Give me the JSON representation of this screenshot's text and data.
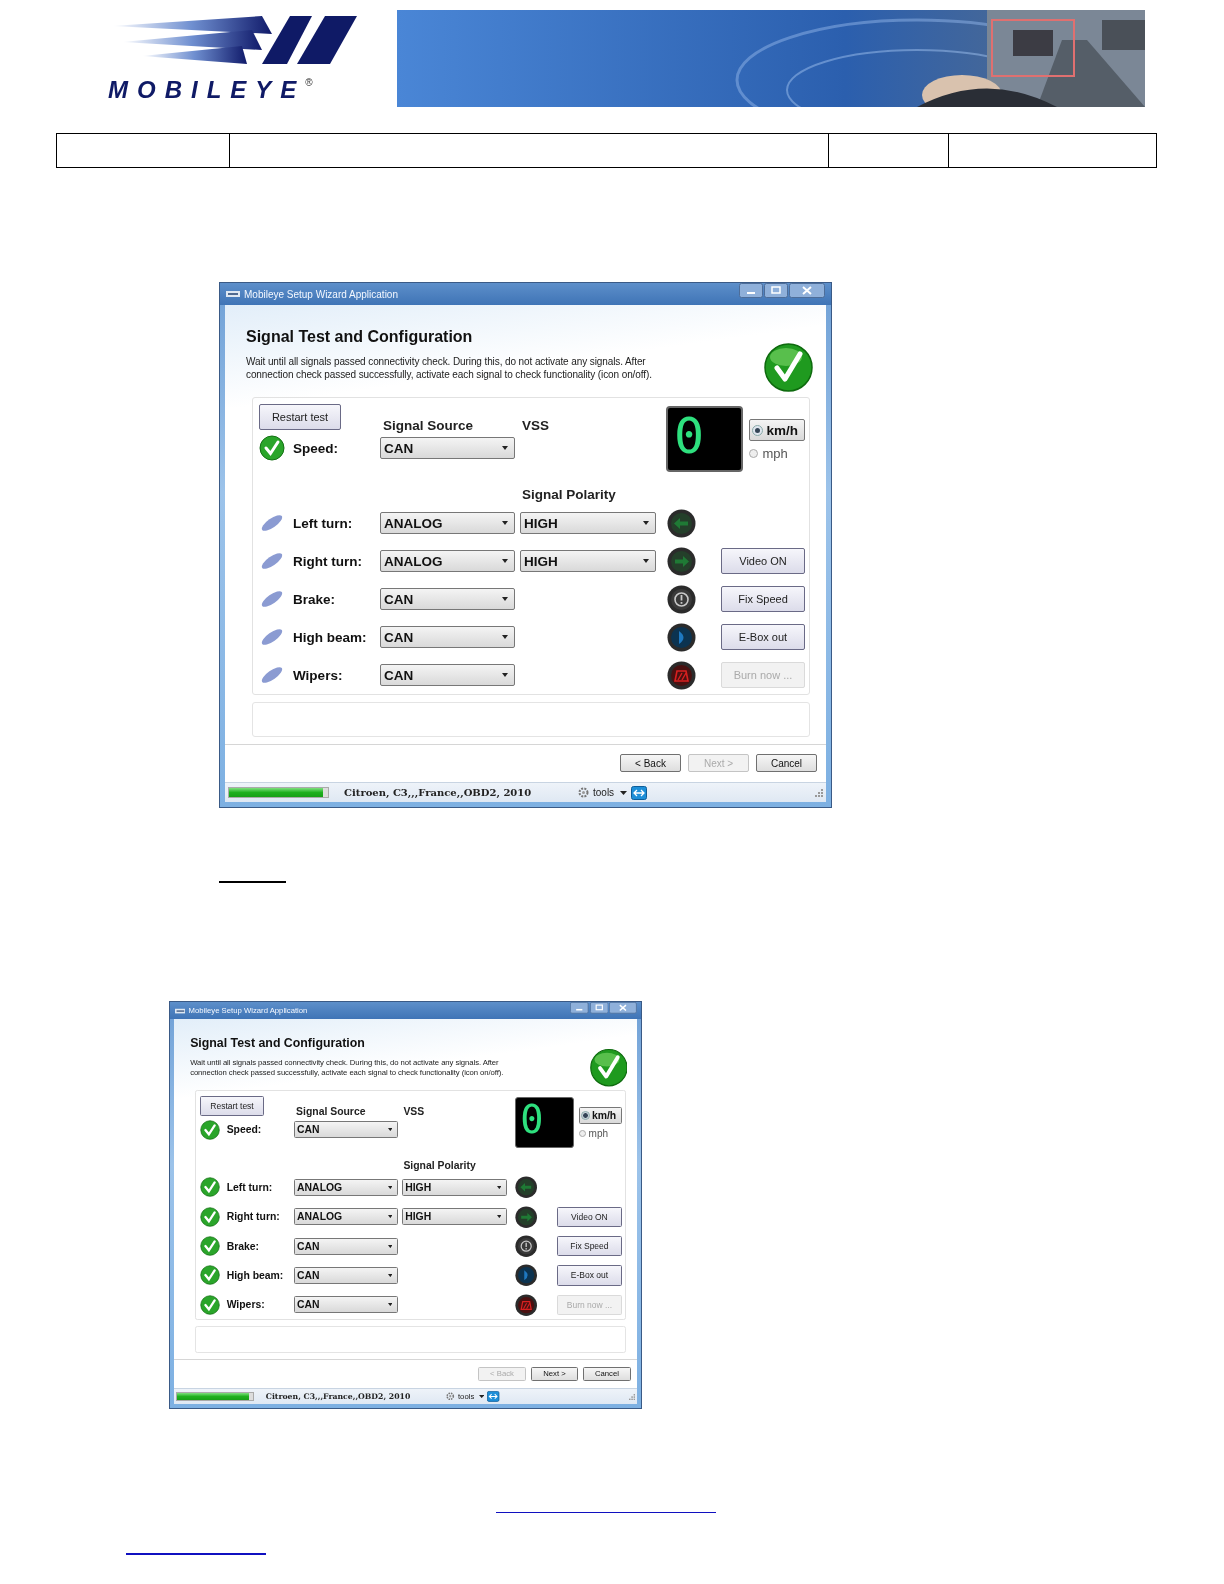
{
  "header": {
    "logo": {
      "text": "MOBILEYE",
      "mark": "®"
    }
  },
  "screenshots": [
    {
      "title": "Mobileye Setup Wizard Application",
      "heading": "Signal Test and Configuration",
      "description": "Wait until all signals passed connectivity check. During this, do not activate any signals. After\nconnection check passed successfully, activate each signal to check functionality (icon on/off).",
      "restart_button": "Restart test",
      "headers": {
        "source": "Signal Source",
        "vss": "VSS",
        "polarity": "Signal Polarity"
      },
      "speed": {
        "label": "Speed:",
        "source": "CAN",
        "passed": true
      },
      "display": "0",
      "units": [
        {
          "label": "km/h",
          "selected": true
        },
        {
          "label": "mph",
          "selected": false
        }
      ],
      "signals": [
        {
          "kind": "left_turn",
          "label": "Left turn:",
          "source": "ANALOG",
          "polarity": "HIGH",
          "passed": false
        },
        {
          "kind": "right_turn",
          "label": "Right turn:",
          "source": "ANALOG",
          "polarity": "HIGH",
          "passed": false
        },
        {
          "kind": "brake",
          "label": "Brake:",
          "source": "CAN",
          "passed": false
        },
        {
          "kind": "high_beam",
          "label": "High beam:",
          "source": "CAN",
          "passed": false
        },
        {
          "kind": "wipers",
          "label": "Wipers:",
          "source": "CAN",
          "passed": false
        }
      ],
      "side_buttons": [
        {
          "label": "Video ON",
          "disabled": false
        },
        {
          "label": "Fix Speed",
          "disabled": false
        },
        {
          "label": "E-Box out",
          "disabled": false
        },
        {
          "label": "Burn now ...",
          "disabled": true
        }
      ],
      "nav_buttons": [
        {
          "label": "< Back",
          "disabled": false
        },
        {
          "label": "Next >",
          "disabled": true
        },
        {
          "label": "Cancel",
          "disabled": false
        }
      ],
      "status": {
        "level": 0.95,
        "vehicle": "Citroen, C3,,,France,,OBD2, 2010",
        "tools": "tools"
      }
    },
    {
      "title": "Mobileye Setup Wizard Application",
      "heading": "Signal Test and Configuration",
      "description": "Wait until all signals passed connectivity check. During this, do not activate any signals. After\nconnection check passed successfully, activate each signal to check functionality (icon on/off).",
      "restart_button": "Restart test",
      "headers": {
        "source": "Signal Source",
        "vss": "VSS",
        "polarity": "Signal Polarity"
      },
      "speed": {
        "label": "Speed:",
        "source": "CAN",
        "passed": true
      },
      "display": "0",
      "units": [
        {
          "label": "km/h",
          "selected": true
        },
        {
          "label": "mph",
          "selected": false
        }
      ],
      "signals": [
        {
          "kind": "left_turn",
          "label": "Left turn:",
          "source": "ANALOG",
          "polarity": "HIGH",
          "passed": true
        },
        {
          "kind": "right_turn",
          "label": "Right turn:",
          "source": "ANALOG",
          "polarity": "HIGH",
          "passed": true
        },
        {
          "kind": "brake",
          "label": "Brake:",
          "source": "CAN",
          "passed": true
        },
        {
          "kind": "high_beam",
          "label": "High beam:",
          "source": "CAN",
          "passed": true
        },
        {
          "kind": "wipers",
          "label": "Wipers:",
          "source": "CAN",
          "passed": true
        }
      ],
      "side_buttons": [
        {
          "label": "Video ON",
          "disabled": false
        },
        {
          "label": "Fix Speed",
          "disabled": false
        },
        {
          "label": "E-Box out",
          "disabled": false
        },
        {
          "label": "Burn now ...",
          "disabled": true
        }
      ],
      "nav_buttons": [
        {
          "label": "< Back",
          "disabled": true
        },
        {
          "label": "Next >",
          "disabled": false
        },
        {
          "label": "Cancel",
          "disabled": false
        }
      ],
      "status": {
        "level": 0.95,
        "vehicle": "Citroen, C3,,,France,,OBD2, 2010",
        "tools": "tools"
      }
    }
  ]
}
